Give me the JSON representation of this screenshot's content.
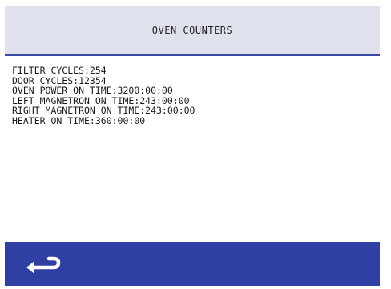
{
  "header": {
    "title": "OVEN COUNTERS"
  },
  "counters": [
    {
      "text": "FILTER CYCLES:254"
    },
    {
      "text": "DOOR CYCLES:12354"
    },
    {
      "text": "OVEN POWER ON TIME:3200:00:00"
    },
    {
      "text": "LEFT MAGNETRON ON TIME:243:00:00"
    },
    {
      "text": "RIGHT MAGNETRON ON TIME:243:00:00"
    },
    {
      "text": "HEATER ON TIME:360:00:00"
    }
  ],
  "footer": {
    "back_icon": "return-arrow-icon"
  },
  "colors": {
    "header_bg": "#dfe1ec",
    "accent": "#2f3fa3",
    "text": "#1a1a1a"
  }
}
